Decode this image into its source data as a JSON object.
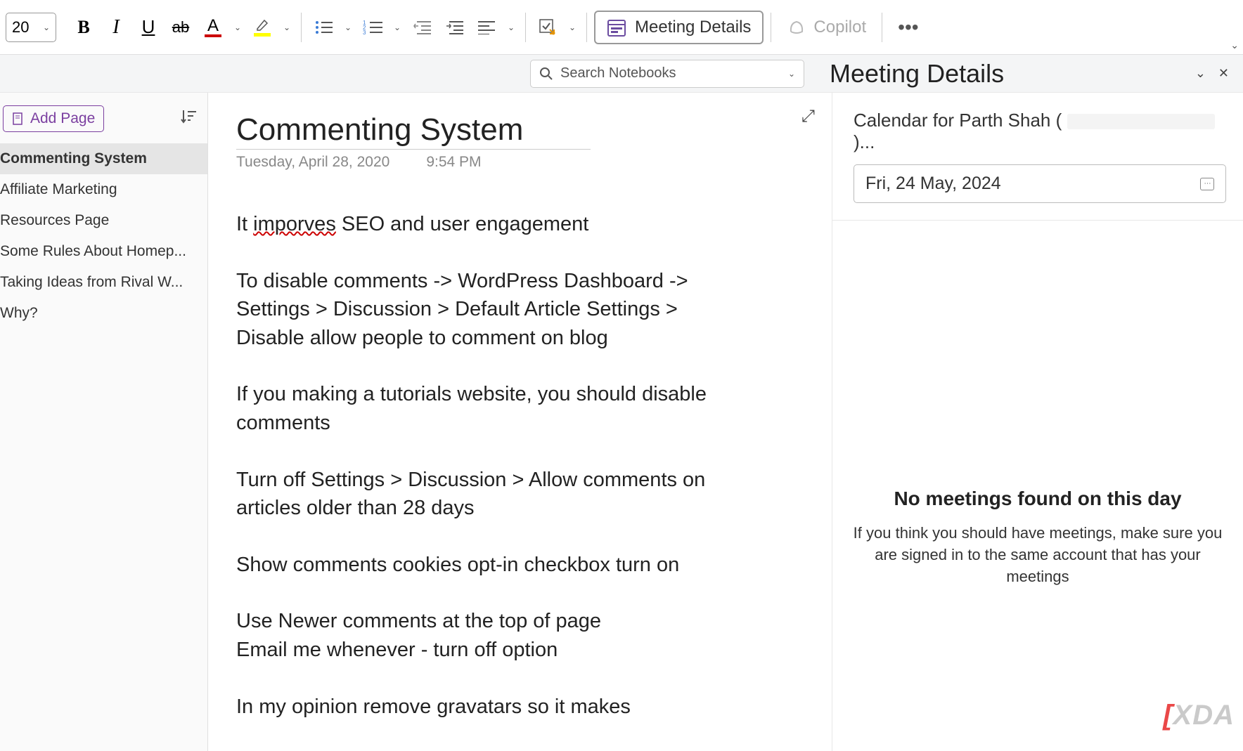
{
  "toolbar": {
    "font_size": "20",
    "meeting_details_label": "Meeting Details",
    "copilot_label": "Copilot"
  },
  "search": {
    "placeholder": "Search Notebooks"
  },
  "sidebar": {
    "add_page_label": "Add Page",
    "pages": [
      {
        "label": "Commenting System",
        "active": true
      },
      {
        "label": "Affiliate Marketing",
        "active": false
      },
      {
        "label": "Resources Page",
        "active": false
      },
      {
        "label": "Some Rules About Homep...",
        "active": false
      },
      {
        "label": "Taking Ideas from Rival W...",
        "active": false
      },
      {
        "label": "Why?",
        "active": false
      }
    ]
  },
  "page": {
    "title": "Commenting System",
    "date": "Tuesday, April 28, 2020",
    "time": "9:54 PM",
    "body_line1_a": "It ",
    "body_line1_err": "imporves",
    "body_line1_b": " SEO and user engagement",
    "para2": "To disable comments -> WordPress Dashboard -> Settings > Discussion > Default Article Settings > Disable allow people to comment on blog",
    "para3": "If you making a tutorials website, you should disable comments",
    "para4": "Turn off Settings > Discussion > Allow comments on articles older than 28 days",
    "para5": "Show comments cookies opt-in checkbox turn on",
    "para6a": "Use Newer comments at the top of page",
    "para6b": "Email me whenever - turn off option",
    "para7": "In my opinion remove gravatars so it makes"
  },
  "panel": {
    "title": "Meeting Details",
    "calendar_for": "Calendar for Parth Shah (",
    "calendar_suffix": ")...",
    "date": "Fri, 24 May, 2024",
    "empty_title": "No meetings found on this day",
    "empty_desc": "If you think you should have meetings, make sure you are signed in to the same account that has your meetings"
  },
  "watermark": {
    "text": "XDA"
  }
}
